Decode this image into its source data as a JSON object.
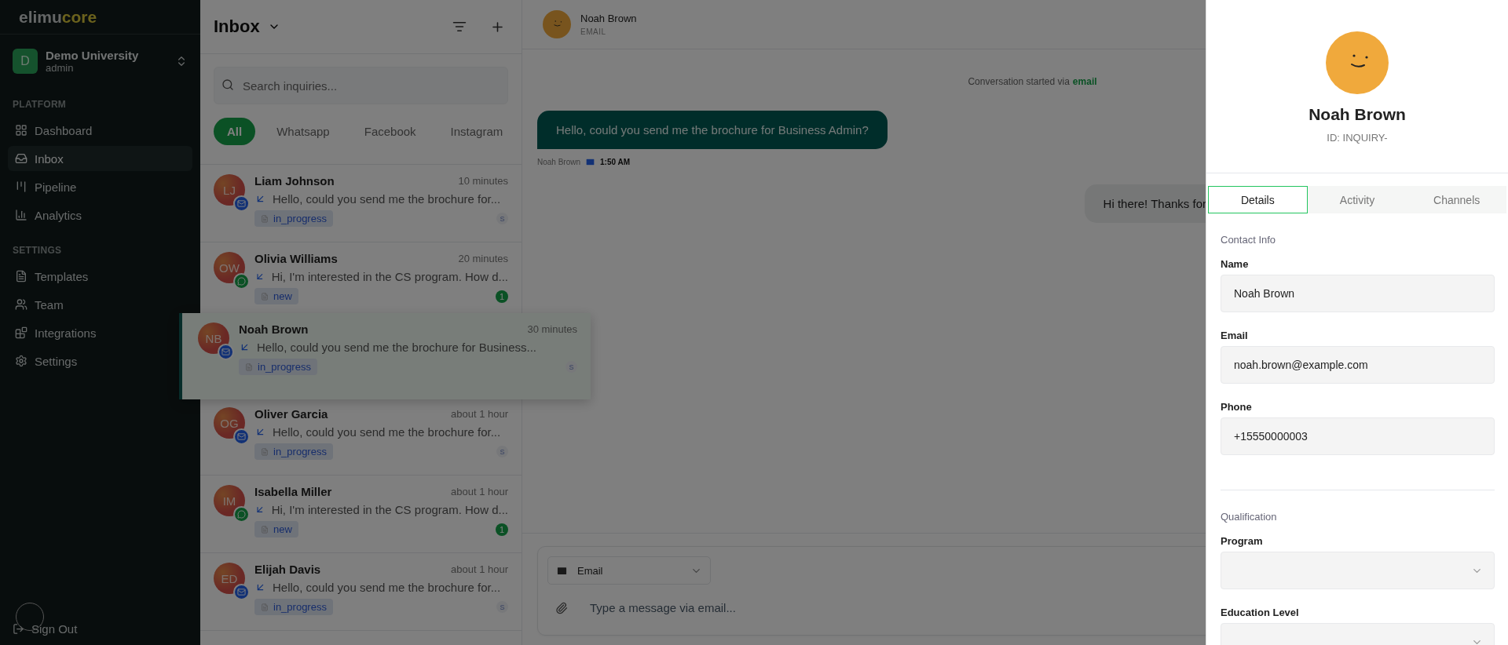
{
  "sidebar": {
    "logo": {
      "first": "elimu",
      "second": "core"
    },
    "org": {
      "initial": "D",
      "name": "Demo University",
      "role": "admin"
    },
    "sections": [
      {
        "title": "PLATFORM",
        "items": [
          {
            "label": "Dashboard",
            "selected": false
          },
          {
            "label": "Inbox",
            "selected": true
          },
          {
            "label": "Pipeline",
            "selected": false
          },
          {
            "label": "Analytics",
            "selected": false
          }
        ]
      },
      {
        "title": "SETTINGS",
        "items": [
          {
            "label": "Templates",
            "selected": false
          },
          {
            "label": "Team",
            "selected": false
          },
          {
            "label": "Integrations",
            "selected": false
          },
          {
            "label": "Settings",
            "selected": false
          }
        ]
      }
    ],
    "sign_out": "Sign Out"
  },
  "inbox": {
    "title": "Inbox",
    "search": {
      "placeholder": "Search inquiries..."
    },
    "filters": [
      {
        "label": "All",
        "selected": true
      },
      {
        "label": "Whatsapp",
        "selected": false
      },
      {
        "label": "Facebook",
        "selected": false
      },
      {
        "label": "Instagram",
        "selected": false
      }
    ],
    "conversations": [
      {
        "name": "Liam Johnson",
        "initials": "LJ",
        "kind": "email",
        "time": "10 minutes",
        "preview": "Hello, could you send me the brochure for...",
        "status": "in_progress",
        "marker": {
          "kind": "assignee",
          "text": "S"
        },
        "dragging": false
      },
      {
        "name": "Olivia Williams",
        "initials": "OW",
        "kind": "whatsapp",
        "time": "20 minutes",
        "preview": "Hi, I'm interested in the CS program. How d...",
        "status": "new",
        "marker": {
          "kind": "unread",
          "text": "1"
        },
        "dragging": false
      },
      {
        "name": "Noah Brown",
        "initials": "NB",
        "kind": "email",
        "time": "30 minutes",
        "preview": "Hello, could you send me the brochure for Business...",
        "status": "in_progress",
        "marker": {
          "kind": "assignee",
          "text": "S"
        },
        "dragging": true
      },
      {
        "name": "Oliver Garcia",
        "initials": "OG",
        "kind": "email",
        "time": "about 1 hour",
        "preview": "Hello, could you send me the brochure for...",
        "status": "in_progress",
        "marker": {
          "kind": "assignee",
          "text": "S"
        },
        "dragging": false
      },
      {
        "name": "Isabella Miller",
        "initials": "IM",
        "kind": "whatsapp",
        "time": "about 1 hour",
        "preview": "Hi, I'm interested in the CS program. How d...",
        "status": "new",
        "marker": {
          "kind": "unread",
          "text": "1"
        },
        "dragging": false
      },
      {
        "name": "Elijah Davis",
        "initials": "ED",
        "kind": "email",
        "time": "about 1 hour",
        "preview": "Hello, could you send me the brochure for...",
        "status": "in_progress",
        "marker": {
          "kind": "assignee",
          "text": "S"
        },
        "dragging": false
      }
    ]
  },
  "chat": {
    "contact": {
      "name": "Noah Brown",
      "channel": "EMAIL"
    },
    "notice": {
      "text": "Conversation started via",
      "channel": "email"
    },
    "messages": [
      {
        "kind": "incoming",
        "text": "Hello, could you send me the brochure for Business Admin?",
        "sender": "Noah Brown",
        "time": "1:50 AM"
      },
      {
        "kind": "outgoing",
        "text": "Hi there! Thanks for"
      }
    ],
    "composer": {
      "channel": "Email",
      "placeholder": "Type a message via email..."
    }
  },
  "contact_panel": {
    "name": "Noah Brown",
    "id": "ID: INQUIRY-",
    "tabs": [
      {
        "label": "Details",
        "selected": true
      },
      {
        "label": "Activity",
        "selected": false
      },
      {
        "label": "Channels",
        "selected": false
      }
    ],
    "sections": [
      {
        "title": "Contact Info",
        "fields": [
          {
            "kind": "text",
            "label": "Name",
            "value": "Noah Brown"
          },
          {
            "kind": "text",
            "label": "Email",
            "value": "noah.brown@example.com"
          },
          {
            "kind": "text",
            "label": "Phone",
            "value": "+15550000003"
          }
        ]
      },
      {
        "title": "Qualification",
        "fields": [
          {
            "kind": "select",
            "label": "Program"
          },
          {
            "kind": "select",
            "label": "Education Level"
          }
        ]
      }
    ]
  }
}
